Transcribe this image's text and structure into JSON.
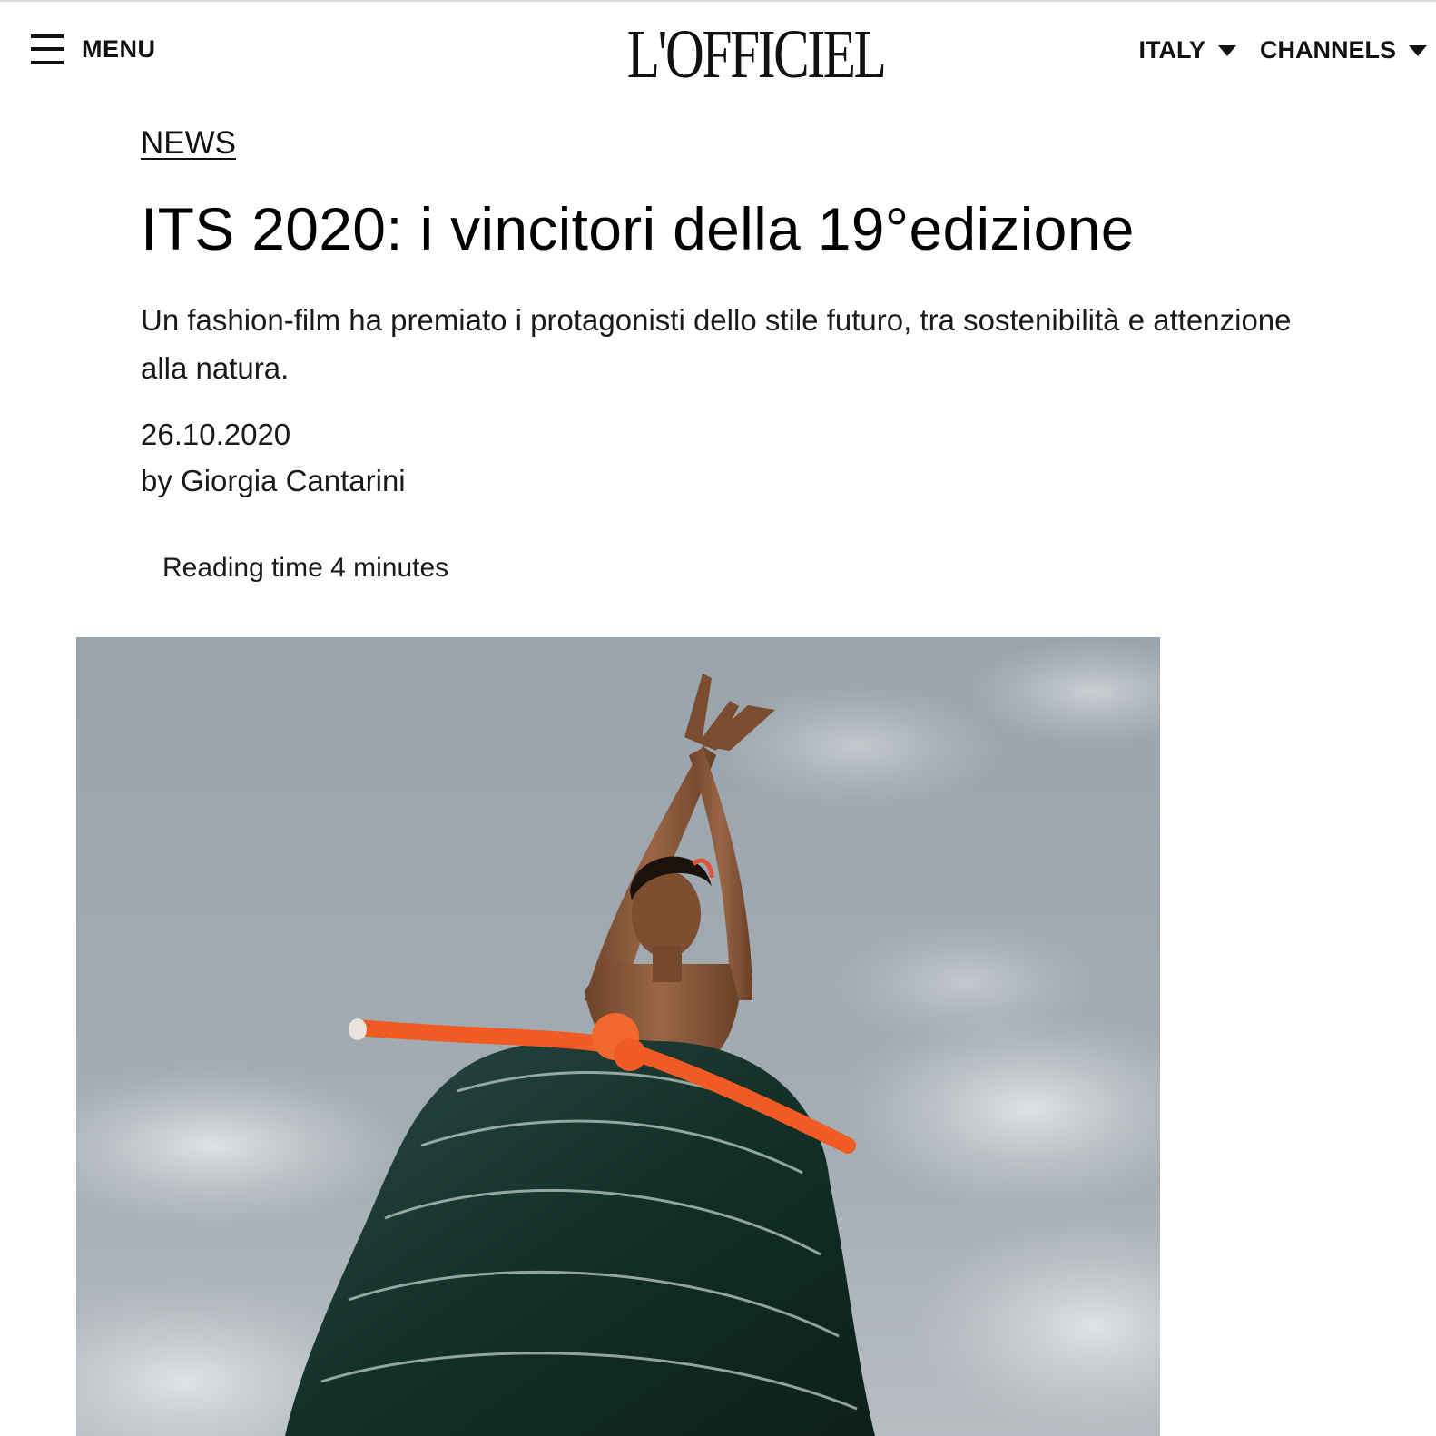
{
  "header": {
    "menu_label": "MENU",
    "logo_text": "L'OFFICIEL",
    "nav": [
      {
        "label": "ITALY"
      },
      {
        "label": "CHANNELS"
      }
    ]
  },
  "article": {
    "category": "NEWS",
    "title": "ITS 2020: i vincitori della 19°edizione",
    "subtitle": "Un fashion-film ha premiato i protagonisti dello stile futuro, tra sostenibilità e attenzione alla natura.",
    "date": "26.10.2020",
    "byline": "by Giorgia Cantarini",
    "reading_time": "Reading time 4 minutes"
  },
  "hero_image": {
    "description_icon": "photo-icon",
    "colors": {
      "sky": "#9ba5ad",
      "cloud": "#d6dade",
      "skin": "#8a5a3c",
      "rope": "#f05a23",
      "dress": "#1f3a34"
    }
  }
}
